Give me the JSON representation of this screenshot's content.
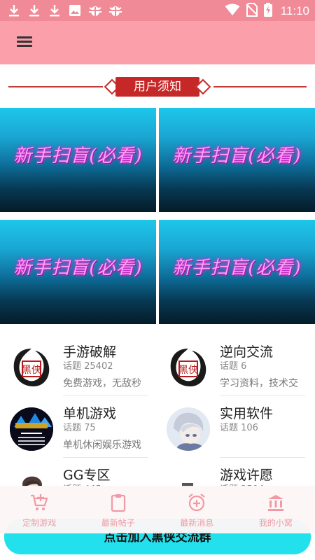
{
  "status_bar": {
    "time": "11:10",
    "left_icons": [
      "download-icon",
      "download-icon",
      "download-icon",
      "image-icon",
      "bug-icon",
      "bug-icon"
    ],
    "right_icons": [
      "wifi-icon",
      "no-sim-icon",
      "battery-charging-icon"
    ]
  },
  "app_bar": {
    "menu_icon": "menu-icon"
  },
  "notice": {
    "label": "用户须知"
  },
  "banners": [
    {
      "text": "新手扫盲(必看)"
    },
    {
      "text": "新手扫盲(必看)"
    },
    {
      "text": "新手扫盲(必看)"
    },
    {
      "text": "新手扫盲(必看)"
    }
  ],
  "forums": [
    {
      "name": "手游破解",
      "count": "话题 25402",
      "desc": "免费游戏，无敌秒",
      "avatar": "ink-logo"
    },
    {
      "name": "逆向交流",
      "count": "话题 6",
      "desc": "学习资料，技术交",
      "avatar": "ink-logo"
    },
    {
      "name": "单机游戏",
      "count": "话题 75",
      "desc": "单机休闲娱乐游戏",
      "avatar": "retro-game-logo"
    },
    {
      "name": "实用软件",
      "count": "话题 106",
      "desc": "",
      "avatar": "anime-avatar"
    },
    {
      "name": "GG专区",
      "count": "话题 445",
      "desc": "",
      "avatar": "character-avatar"
    },
    {
      "name": "游戏许愿",
      "count": "话题 2504",
      "desc": "",
      "avatar": "small-logo"
    }
  ],
  "join_button": {
    "label": "点击加入黑侠交流群"
  },
  "bottom_nav": {
    "items": [
      {
        "label": "定制游戏",
        "icon": "cart-plus-icon"
      },
      {
        "label": "最新帖子",
        "icon": "clipboard-icon"
      },
      {
        "label": "最新消息",
        "icon": "alarm-add-icon"
      },
      {
        "label": "我的小窝",
        "icon": "bank-icon"
      }
    ]
  },
  "colors": {
    "status_bar": "#f08a97",
    "app_bar": "#fb9fab",
    "notice_red": "#c62828",
    "nav_label": "#f19aa4",
    "join_button": "#23e1ec"
  }
}
